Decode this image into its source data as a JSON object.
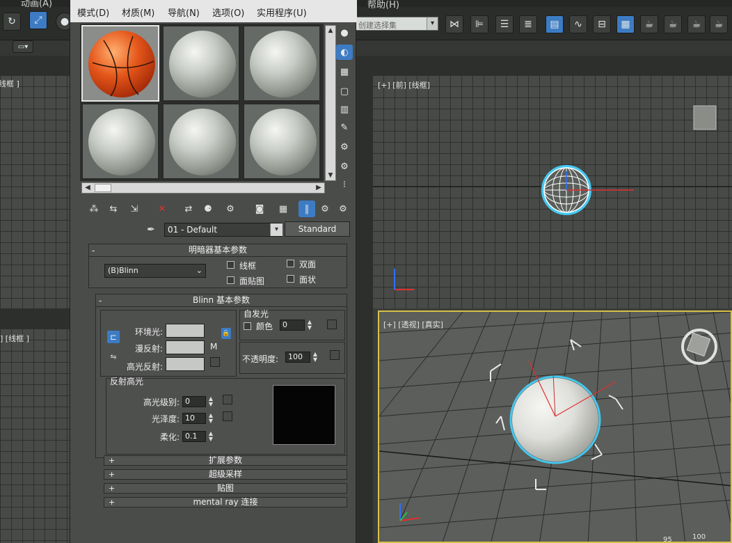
{
  "app_menu": {
    "top_left": "动画(A)",
    "help": "帮助(H)"
  },
  "toolbar": {
    "selection_set_label": "创建选择集"
  },
  "viewports": {
    "front_label": "[+] [前] [线框]",
    "perspective_label": "[+] [透视] [真实]",
    "left_top_label": "线框 ]",
    "left_bottom_label": "] [线框 ]",
    "perspective_ruler": [
      "95",
      "100"
    ]
  },
  "material_editor": {
    "menu": [
      "模式(D)",
      "材质(M)",
      "导航(N)",
      "选项(O)",
      "实用程序(U)"
    ],
    "material_name": "01 - Default",
    "material_type": "Standard",
    "shader_rollout": {
      "title": "明暗器基本参数",
      "shader": "(B)Blinn",
      "wire": "线框",
      "two_sided": "双面",
      "face_map": "面贴图",
      "faceted": "面状"
    },
    "blinn_rollout": {
      "title": "Blinn 基本参数",
      "ambient": "环境光:",
      "diffuse": "漫反射:",
      "specular": "高光反射:",
      "map_button": "M",
      "self_illum_title": "自发光",
      "color": "颜色",
      "color_value": "0",
      "opacity": "不透明度:",
      "opacity_value": "100",
      "spec_title": "反射高光",
      "spec_level": "高光级别:",
      "spec_level_value": "0",
      "glossiness": "光泽度:",
      "glossiness_value": "10",
      "soften": "柔化:",
      "soften_value": "0.1"
    },
    "collapsed_rollouts": [
      "扩展参数",
      "超级采样",
      "贴图",
      "mental ray 连接"
    ]
  },
  "colors": {
    "accent": "#3d7cc4",
    "active_viewport_border": "#d8c04a",
    "selection_ring": "#44c8f0",
    "axis_x": "#e03030",
    "axis_y": "#30c040",
    "axis_z": "#3070ff"
  }
}
